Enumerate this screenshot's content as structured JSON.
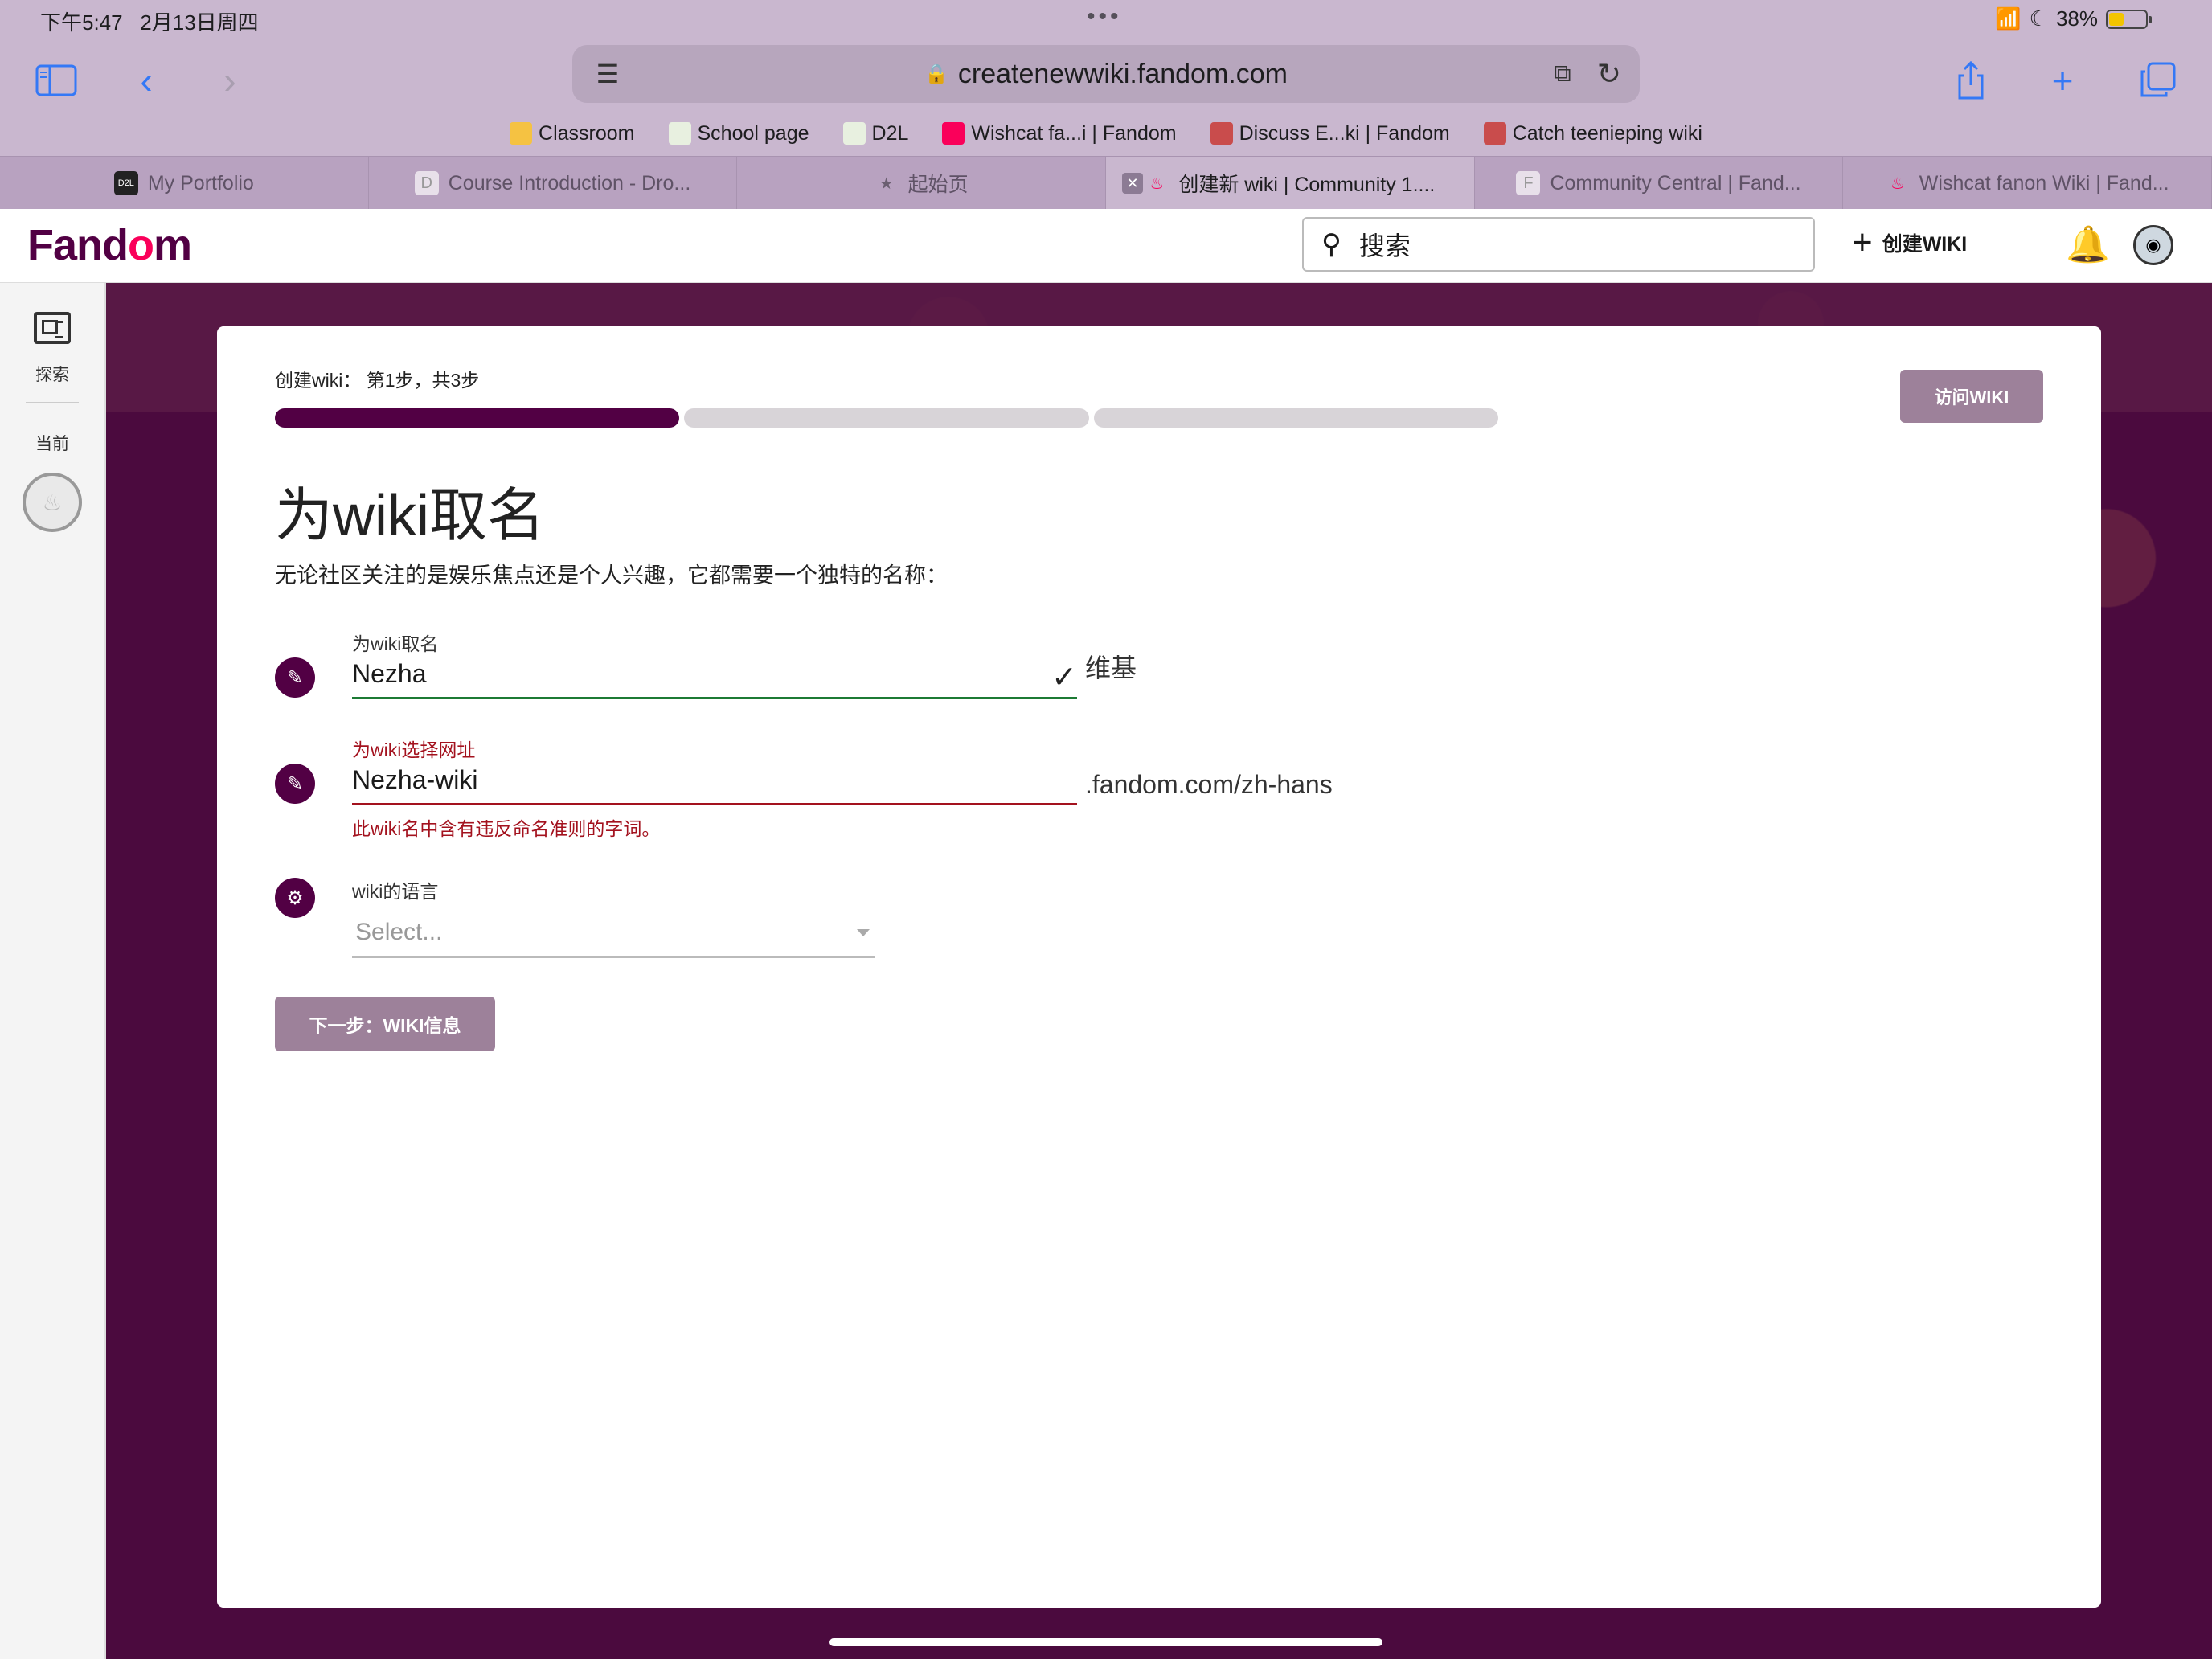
{
  "status": {
    "time": "下午5:47",
    "date": "2月13日周四",
    "battery_percent": "38%",
    "battery_level": 0.38
  },
  "safari": {
    "url": "createnewwiki.fandom.com",
    "bookmarks": [
      {
        "label": "Classroom",
        "icon": "classroom-icon",
        "color": "#f5c242"
      },
      {
        "label": "School page",
        "icon": "school-icon",
        "color": "#e8f0e0"
      },
      {
        "label": "D2L",
        "icon": "d2l-icon",
        "color": "#e8f0e0"
      },
      {
        "label": "Wishcat fa...i | Fandom",
        "icon": "fandom-flame-icon",
        "color": "#fa005a"
      },
      {
        "label": "Discuss E...ki | Fandom",
        "icon": "discuss-icon",
        "color": "#c94c4c"
      },
      {
        "label": "Catch teenieping wiki",
        "icon": "teenieping-icon",
        "color": "#c94c4c"
      }
    ],
    "tabs": [
      {
        "label": "My Portfolio",
        "icon": "d2l-icon",
        "active": false
      },
      {
        "label": "Course Introduction - Dro...",
        "icon": "d-letter-icon",
        "active": false
      },
      {
        "label": "起始页",
        "icon": "star-icon",
        "active": false
      },
      {
        "label": "创建新 wiki | Community 1....",
        "icon": "fandom-flame-icon",
        "active": true
      },
      {
        "label": "Community Central | Fand...",
        "icon": "f-letter-icon",
        "active": false
      },
      {
        "label": "Wishcat fanon Wiki | Fand...",
        "icon": "fandom-flame-icon",
        "active": false
      }
    ]
  },
  "header": {
    "logo_left": "Fand",
    "logo_mid": "o",
    "logo_right": "m",
    "search_placeholder": "搜索",
    "create_wiki": "创建WIKI"
  },
  "rail": {
    "explore": "探索",
    "current": "当前"
  },
  "form": {
    "step_label": "创建wiki：  第1步，共3步",
    "progress_fraction": 0.333,
    "visit_button": "访问WIKI",
    "title": "为wiki取名",
    "subtitle": "无论社区关注的是娱乐焦点还是个人兴趣，它都需要一个独特的名称：",
    "name_field": {
      "label": "为wiki取名",
      "value": "Nezha",
      "suffix": "维基"
    },
    "url_field": {
      "label": "为wiki选择网址",
      "value": "Nezha-wiki",
      "suffix": ".fandom.com/zh-hans",
      "error": "此wiki名中含有违反命名准则的字词。"
    },
    "language_field": {
      "label": "wiki的语言",
      "placeholder": "Select..."
    },
    "next_button": "下一步：WIKI信息"
  },
  "colors": {
    "brand": "#520044",
    "accent": "#fa005a",
    "error": "#a3121e",
    "success": "#1c7a34"
  }
}
